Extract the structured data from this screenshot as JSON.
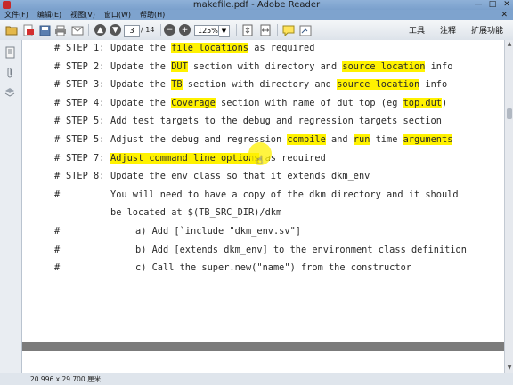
{
  "window": {
    "title": "makefile.pdf - Adobe Reader",
    "buttons": {
      "minimize": "—",
      "maximize": "□",
      "close": "✕"
    }
  },
  "menu": {
    "items": [
      "文件(F)",
      "编辑(E)",
      "视图(V)",
      "窗口(W)",
      "帮助(H)"
    ],
    "close_glyph": "✕"
  },
  "toolbar": {
    "page_current": "3",
    "page_total": "/ 14",
    "zoom": "125%",
    "zoom_arrow": "▼",
    "right_links": [
      "工具",
      "注释",
      "扩展功能"
    ]
  },
  "icons": {
    "open": "open-folder-icon",
    "convert": "pdf-convert-icon",
    "save": "save-icon",
    "print": "print-icon",
    "email": "email-icon",
    "prev": "page-up-icon",
    "next": "page-down-icon",
    "zoom_out": "zoom-out-icon",
    "zoom_in": "zoom-in-icon",
    "fit_page": "fit-page-icon",
    "fit_width": "fit-width-icon",
    "comment": "comment-icon",
    "sign": "sign-icon"
  },
  "document": {
    "lines": [
      {
        "hash": "#",
        "step": "STEP 1:",
        "parts": [
          {
            "t": "Update the "
          },
          {
            "t": "file locations",
            "hl": true
          },
          {
            "t": " as required"
          }
        ]
      },
      {
        "hash": "#",
        "step": "STEP 2:",
        "parts": [
          {
            "t": "Update the "
          },
          {
            "t": "DUT",
            "hl": true
          },
          {
            "t": " section with directory and "
          },
          {
            "t": "source location",
            "hl": true
          },
          {
            "t": " info"
          }
        ]
      },
      {
        "hash": "#",
        "step": "STEP 3:",
        "parts": [
          {
            "t": "Update the "
          },
          {
            "t": "TB",
            "hl": true
          },
          {
            "t": " section with directory and "
          },
          {
            "t": "source location",
            "hl": true
          },
          {
            "t": " info"
          }
        ]
      },
      {
        "hash": "#",
        "step": "STEP 4:",
        "parts": [
          {
            "t": "Update the "
          },
          {
            "t": "Coverage",
            "hl": true
          },
          {
            "t": " section with name of dut top (eg "
          },
          {
            "t": "top.dut",
            "hl": true
          },
          {
            "t": ")"
          }
        ]
      },
      {
        "hash": "#",
        "step": "STEP 5:",
        "parts": [
          {
            "t": "Add test targets to the debug and regression targets section"
          }
        ]
      },
      {
        "hash": "#",
        "step": "STEP 5:",
        "parts": [
          {
            "t": "Adjust the debug and regression "
          },
          {
            "t": "compile",
            "hl": true
          },
          {
            "t": " and "
          },
          {
            "t": "run",
            "hl": true
          },
          {
            "t": " time "
          },
          {
            "t": "arguments",
            "hl": true
          }
        ]
      },
      {
        "hash": "#",
        "step": "STEP 7:",
        "parts": [
          {
            "t": "Adjust command line options",
            "hl": true
          },
          {
            "t": " as required"
          }
        ]
      },
      {
        "hash": "#",
        "step": "STEP 8:",
        "parts": [
          {
            "t": "Update the env class so that it extends dkm_env"
          }
        ]
      },
      {
        "hash": "#",
        "step": "",
        "parts": [
          {
            "t": "You will need to have a copy of the dkm directory and it should"
          }
        ]
      },
      {
        "hash": "",
        "step": "",
        "parts": [
          {
            "t": "be located at $(TB_SRC_DIR)/dkm"
          }
        ]
      },
      {
        "hash": "#",
        "step": "",
        "sub": true,
        "parts": [
          {
            "t": "a) Add [`include \"dkm_env.sv\"]"
          }
        ]
      },
      {
        "hash": "#",
        "step": "",
        "sub": true,
        "parts": [
          {
            "t": "b) Add [extends dkm_env] to the environment class definition"
          }
        ]
      },
      {
        "hash": "#",
        "step": "",
        "sub": true,
        "parts": [
          {
            "t": "c) Call the super.new(\"name\") from the constructor"
          }
        ]
      }
    ]
  },
  "status": {
    "page_size": "20.996 x 29.700 厘米"
  },
  "colors": {
    "highlight": "#fff200"
  }
}
